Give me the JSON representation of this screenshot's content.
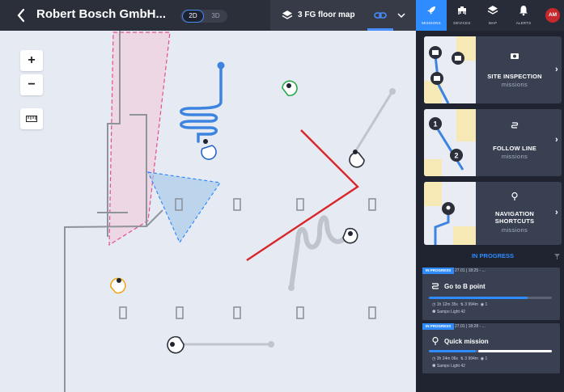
{
  "header": {
    "back_icon": "chevron-left-icon",
    "site_name": "Robert Bosch GmbH...",
    "view_toggle": [
      "2D",
      "3D"
    ],
    "active_view": "2D",
    "floor_label": "3 FG floor map",
    "layers_icon": "layers-icon",
    "link_icon": "link-icon",
    "dropdown_icon": "chevron-down-icon"
  },
  "map_controls": {
    "zoom_in": "+",
    "zoom_out": "−",
    "measure_icon": "ruler-icon"
  },
  "nav": {
    "items": [
      {
        "label": "MISSIONS",
        "icon": "rocket-icon",
        "active": true
      },
      {
        "label": "DEVICES",
        "icon": "robot-dog-icon",
        "active": false
      },
      {
        "label": "MAP",
        "icon": "layers-icon",
        "active": false
      },
      {
        "label": "ALERTS",
        "icon": "bell-icon",
        "active": false
      }
    ],
    "avatar_initials": "AM"
  },
  "mission_types": [
    {
      "title": "SITE INSPECTION",
      "subtitle": "missions",
      "icon": "camera-icon"
    },
    {
      "title": "FOLLOW LINE",
      "subtitle": "missions",
      "icon": "route-icon"
    },
    {
      "title": "NAVIGATION SHORTCUTS",
      "subtitle": "missions",
      "icon": "pin-icon"
    }
  ],
  "in_progress": {
    "heading": "IN PROGRESS",
    "filter_icon": "filter-icon",
    "missions": [
      {
        "badge": "IN PROGRESS",
        "time": "27.01 | 18:25 - ...",
        "name": "Go to B point",
        "icon": "route-icon",
        "progress": 0.8,
        "duration": "1h 12m 35s",
        "distance": "3 994m",
        "count": "1",
        "robot": "Sampo Light 42"
      },
      {
        "badge": "IN PROGRESS",
        "time": "27.01 | 18:28 - ...",
        "name": "Quick mission",
        "icon": "pin-icon",
        "progress": 0.38,
        "duration": "3h 24m 06s",
        "distance": "3 994m",
        "count": "1",
        "robot": "Sampo Light 42"
      }
    ]
  },
  "colors": {
    "accent": "#2f8cff",
    "topbar": "#2b2f3a",
    "panel": "#1f2430",
    "card": "#384052",
    "route_red": "#d9262b",
    "robot_green": "#2aa84a",
    "robot_orange": "#f0a81d"
  }
}
